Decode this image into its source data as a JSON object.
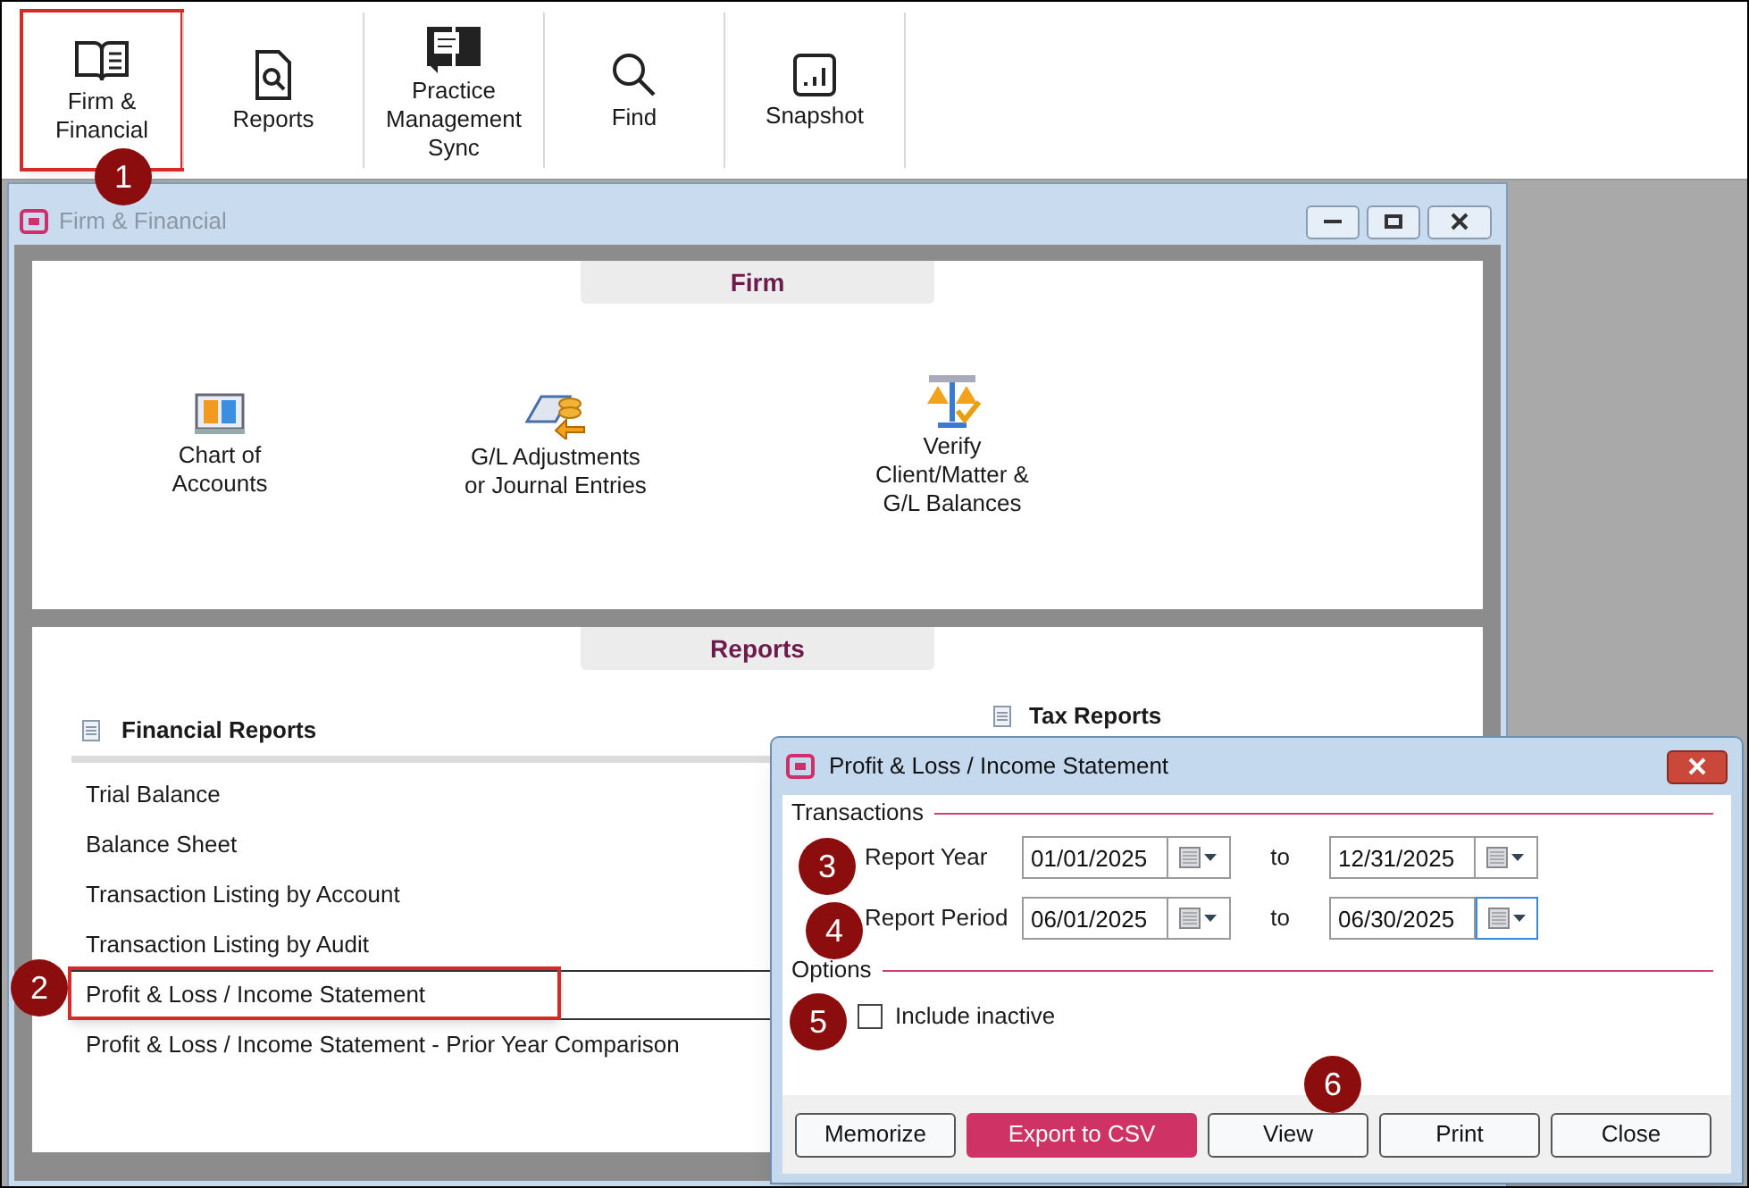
{
  "toolbar": [
    {
      "label": "Firm &\nFinancial",
      "kind": "book",
      "highlighted": true
    },
    {
      "label": "Reports",
      "kind": "report",
      "highlighted": false
    },
    {
      "label": "Practice\nManagement\nSync",
      "kind": "sync",
      "highlighted": false
    },
    {
      "label": "Find",
      "kind": "find",
      "highlighted": false
    },
    {
      "label": "Snapshot",
      "kind": "snapshot",
      "highlighted": false
    }
  ],
  "main_window": {
    "title": "Firm & Financial",
    "firm_section": {
      "title": "Firm",
      "items": [
        {
          "label": "Chart of\nAccounts",
          "kind": "chart"
        },
        {
          "label": "G/L Adjustments\nor Journal Entries",
          "kind": "adjust"
        },
        {
          "label": "Verify\nClient/Matter &\nG/L Balances",
          "kind": "verify"
        }
      ]
    },
    "reports_section": {
      "title": "Reports",
      "financial_reports": {
        "title": "Financial Reports",
        "items": [
          {
            "label": "Trial Balance",
            "selected": false,
            "highlighted": false
          },
          {
            "label": "Balance Sheet",
            "selected": false,
            "highlighted": false
          },
          {
            "label": "Transaction Listing by Account",
            "selected": false,
            "highlighted": false
          },
          {
            "label": "Transaction Listing by Audit",
            "selected": false,
            "highlighted": false
          },
          {
            "label": "Profit & Loss / Income Statement",
            "selected": true,
            "highlighted": true
          },
          {
            "label": "Profit & Loss / Income Statement - Prior Year Comparison",
            "selected": false,
            "highlighted": false
          }
        ]
      },
      "tax_reports": {
        "title": "Tax Reports"
      }
    }
  },
  "dialog": {
    "title": "Profit & Loss / Income Statement",
    "transactions": {
      "title": "Transactions",
      "rows": [
        {
          "label": "Report Year",
          "from": {
            "value": "01/01/2025",
            "focused": false
          },
          "to_label": "to",
          "to": {
            "value": "12/31/2025",
            "focused": false
          }
        },
        {
          "label": "Report Period",
          "from": {
            "value": "06/01/2025",
            "focused": false
          },
          "to_label": "to",
          "to": {
            "value": "06/30/2025",
            "focused": true
          }
        }
      ]
    },
    "options": {
      "title": "Options",
      "checkbox": {
        "label": "Include inactive",
        "checked": false
      }
    },
    "buttons": [
      {
        "label": "Memorize",
        "primary": false
      },
      {
        "label": "Export to CSV",
        "primary": true
      },
      {
        "label": "View",
        "primary": false
      },
      {
        "label": "Print",
        "primary": false
      },
      {
        "label": "Close",
        "primary": false
      }
    ]
  },
  "annotations": [
    {
      "number": "1"
    },
    {
      "number": "2"
    },
    {
      "number": "3"
    },
    {
      "number": "4"
    },
    {
      "number": "5"
    },
    {
      "number": "6"
    }
  ]
}
